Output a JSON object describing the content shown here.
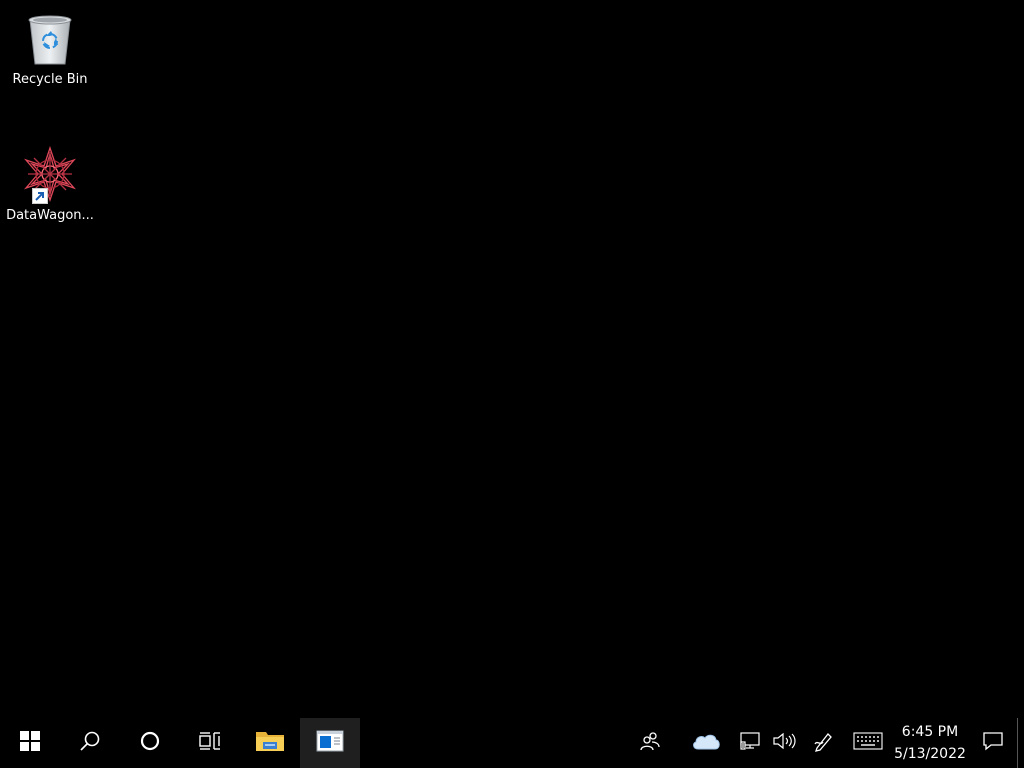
{
  "desktop": {
    "icons": [
      {
        "label": "Recycle Bin",
        "icon": "recycle-bin-icon"
      },
      {
        "label": "DataWagon...",
        "icon": "datawagon-app-icon"
      }
    ]
  },
  "taskbar": {
    "start": {
      "icon": "windows-logo-icon"
    },
    "search": {
      "icon": "search-icon"
    },
    "cortana": {
      "icon": "cortana-circle-icon"
    },
    "task_view": {
      "icon": "task-view-icon"
    },
    "pinned": [
      {
        "icon": "file-explorer-icon"
      },
      {
        "icon": "app-window-icon",
        "active": true
      }
    ],
    "tray": {
      "people": "people-icon",
      "onedrive": "onedrive-cloud-icon",
      "network": "network-icon",
      "volume": "volume-icon",
      "pen": "pen-workspace-icon",
      "keyboard": "touch-keyboard-icon"
    },
    "clock": {
      "time": "6:45 PM",
      "date": "5/13/2022"
    },
    "notifications": {
      "icon": "action-center-icon"
    }
  },
  "colors": {
    "desktop_bg": "#000000",
    "taskbar_bg": "#000000",
    "active_app_bg": "#1f1f1f",
    "accent": "#0078d7"
  }
}
